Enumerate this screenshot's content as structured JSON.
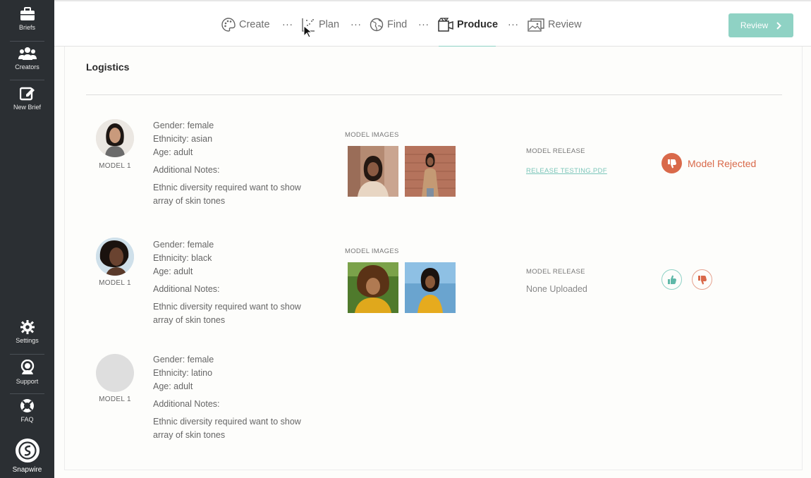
{
  "sidebar": {
    "items": [
      {
        "label": "Briefs",
        "icon": "briefcase-icon"
      },
      {
        "label": "Creators",
        "icon": "users-icon"
      },
      {
        "label": "New Brief",
        "icon": "edit-icon"
      }
    ],
    "bottom_items": [
      {
        "label": "Settings",
        "icon": "gear-icon"
      },
      {
        "label": "Support",
        "icon": "headset-icon"
      },
      {
        "label": "FAQ",
        "icon": "lifebuoy-icon"
      }
    ],
    "brand": "Snapwire"
  },
  "nav": {
    "steps": [
      {
        "label": "Create",
        "icon": "palette-icon"
      },
      {
        "label": "Plan",
        "icon": "plan-icon"
      },
      {
        "label": "Find",
        "icon": "globe-icon"
      },
      {
        "label": "Produce",
        "icon": "clapper-icon"
      },
      {
        "label": "Review",
        "icon": "images-icon"
      }
    ],
    "active": "Produce",
    "dots": "···",
    "review_button": "Review"
  },
  "section": {
    "title": "Logistics"
  },
  "models": [
    {
      "label": "MODEL 1",
      "gender": "Gender: female",
      "ethnicity": "Ethnicity: asian",
      "age": "Age: adult",
      "notes_label": "Additional Notes:",
      "notes": "Ethnic diversity required want to show array of skin tones",
      "images_title": "MODEL IMAGES",
      "release_title": "MODEL RELEASE",
      "release_value": "RELEASE TESTING.PDF",
      "status": "Model Rejected"
    },
    {
      "label": "MODEL 1",
      "gender": "Gender: female",
      "ethnicity": "Ethnicity: black",
      "age": "Age: adult",
      "notes_label": "Additional Notes:",
      "notes": "Ethnic diversity required want to show array of skin tones",
      "images_title": "MODEL IMAGES",
      "release_title": "MODEL RELEASE",
      "release_value": "None Uploaded"
    },
    {
      "label": "MODEL 1",
      "gender": "Gender: female",
      "ethnicity": "Ethnicity: latino",
      "age": "Age: adult",
      "notes_label": "Additional Notes:",
      "notes": "Ethnic diversity required want to show array of skin tones"
    }
  ],
  "colors": {
    "accent": "#8fd2c6",
    "reject": "#d9694a",
    "sidebar": "#2b2f33"
  }
}
